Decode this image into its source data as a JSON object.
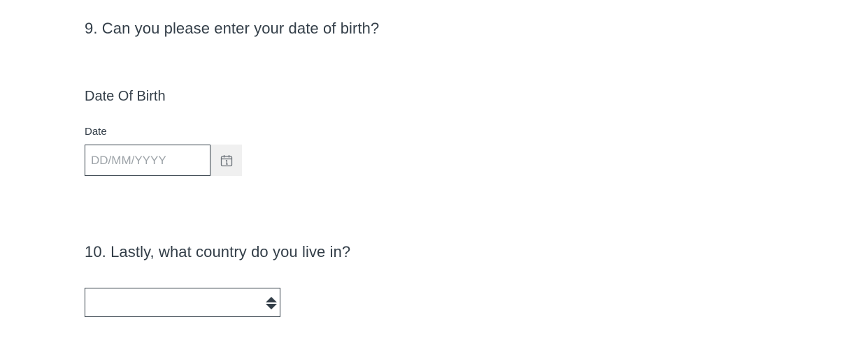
{
  "questions": {
    "q9": {
      "title": "9. Can you please enter your date of birth?",
      "group_label": "Date Of Birth",
      "field_label": "Date",
      "date_value": "",
      "date_placeholder": "DD/MM/YYYY",
      "calendar_icon": "calendar-icon"
    },
    "q10": {
      "title": "10. Lastly, what country do you live in?",
      "selected_value": "",
      "select_icon": "up-down-arrows-icon"
    }
  },
  "colors": {
    "text": "#333e48",
    "placeholder": "#9da3a8",
    "calendar_button_bg": "#f0f0f0"
  }
}
